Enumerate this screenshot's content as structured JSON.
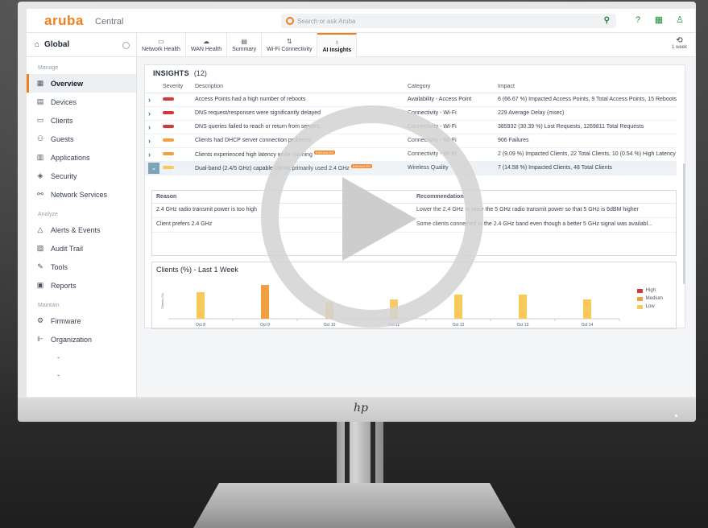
{
  "app": {
    "brand": "aruba",
    "product": "Central",
    "search_placeholder": "Search or ask Aruba",
    "top_icons": [
      "search-icon",
      "help-icon",
      "apps-grid-icon",
      "user-icon"
    ]
  },
  "sidebar": {
    "scope_label": "Global",
    "sections": [
      {
        "label": "Manage",
        "items": [
          {
            "label": "Overview",
            "icon": "grid-icon",
            "glyph": "▦",
            "active": true
          },
          {
            "label": "Devices",
            "icon": "devices-icon",
            "glyph": "▤"
          },
          {
            "label": "Clients",
            "icon": "laptop-icon",
            "glyph": "▭"
          },
          {
            "label": "Guests",
            "icon": "guests-icon",
            "glyph": "⚇"
          },
          {
            "label": "Applications",
            "icon": "applications-icon",
            "glyph": "▥"
          },
          {
            "label": "Security",
            "icon": "shield-icon",
            "glyph": "◈"
          },
          {
            "label": "Network Services",
            "icon": "network-services-icon",
            "glyph": "⚯"
          }
        ]
      },
      {
        "label": "Analyze",
        "items": [
          {
            "label": "Alerts & Events",
            "icon": "bell-icon",
            "glyph": "△"
          },
          {
            "label": "Audit Trail",
            "icon": "audit-icon",
            "glyph": "▨"
          },
          {
            "label": "Tools",
            "icon": "wrench-icon",
            "glyph": "✎"
          },
          {
            "label": "Reports",
            "icon": "reports-icon",
            "glyph": "▣"
          }
        ]
      },
      {
        "label": "Maintain",
        "items": [
          {
            "label": "Firmware",
            "icon": "gear-icon",
            "glyph": "⚙"
          },
          {
            "label": "Organization",
            "icon": "organization-icon",
            "glyph": "⊩"
          }
        ]
      }
    ],
    "trailing": [
      "-",
      "-"
    ]
  },
  "tabs": [
    {
      "label": "Network Health",
      "icon": "monitor-icon",
      "glyph": "▭"
    },
    {
      "label": "WAN Health",
      "icon": "cloud-icon",
      "glyph": "☁"
    },
    {
      "label": "Summary",
      "icon": "summary-icon",
      "glyph": "▤"
    },
    {
      "label": "Wi-Fi Connectivity",
      "icon": "wifi-icon",
      "glyph": "⇅"
    },
    {
      "label": "AI Insights",
      "icon": "lightbulb-icon",
      "glyph": "♁",
      "active": true
    }
  ],
  "time_range": {
    "label": "1 week"
  },
  "insights": {
    "title": "INSIGHTS",
    "count": "(12)",
    "columns": [
      "Severity",
      "Description",
      "Category",
      "Impact"
    ],
    "rows": [
      {
        "severity": "high",
        "description": "Access Points had a high number of reboots",
        "tag": "",
        "category": "Availability - Access Point",
        "impact": "6 (66.67 %) Impacted Access Points, 9 Total Access Points, 15 Reboots"
      },
      {
        "severity": "high",
        "description": "DNS request/responses were significantly delayed",
        "tag": "",
        "category": "Connectivity - Wi-Fi",
        "impact": "229 Average Delay (msec)"
      },
      {
        "severity": "high",
        "description": "DNS queries failed to reach or return from servers",
        "tag": "",
        "category": "Connectivity - Wi-Fi",
        "impact": "385932 (30.39 %) Lost Requests, 1269811 Total Requests"
      },
      {
        "severity": "medium",
        "description": "Clients had DHCP server connection problems",
        "tag": "",
        "category": "Connectivity - Wi-Fi",
        "impact": "906 Failures"
      },
      {
        "severity": "medium",
        "description": "Clients experienced high latency while roaming",
        "tag": "ENHANCED",
        "category": "Connectivity - Wi-Fi",
        "impact": "2 (9.09 %) Impacted Clients, 22 Total Clients, 10 (0.54 %) High Latency"
      },
      {
        "severity": "low",
        "description": "Dual-band (2.4/5 GHz) capable clients primarily used 2.4 GHz",
        "tag": "ENHANCED",
        "category": "Wireless Quality",
        "impact": "7 (14.58 %) Impacted Clients, 48 Total Clients",
        "expanded": true
      }
    ]
  },
  "detail": {
    "columns": [
      "Reason",
      "Recommendation"
    ],
    "rows": [
      {
        "reason": "2.4 GHz radio transmit power is too high",
        "recommendation": "Lower the 2.4 GHz or raise the 5 GHz radio transmit power so that 5 GHz is 6dBM higher"
      },
      {
        "reason": "Client prefers 2.4 GHz",
        "recommendation": "Some clients connected to the 2.4 GHz band even though a better 5 GHz signal was availabl..."
      }
    ]
  },
  "chart_data": {
    "type": "bar",
    "title": "Clients (%) - Last 1 Week",
    "ylabel": "Clients (%)",
    "categories": [
      "Oct 8",
      "Oct 9",
      "Oct 10",
      "Oct 11",
      "Oct 12",
      "Oct 13",
      "Oct 14"
    ],
    "series": [
      {
        "name": "High",
        "color": "#d23a3a",
        "values": [
          0,
          0,
          0,
          0,
          0,
          0,
          0
        ]
      },
      {
        "name": "Medium",
        "color": "#f0a040",
        "values": [
          0,
          14,
          0,
          0,
          0,
          0,
          0
        ]
      },
      {
        "name": "Low",
        "color": "#f7c85a",
        "values": [
          11,
          0,
          7,
          8,
          10,
          10,
          8
        ]
      }
    ],
    "ylim": [
      0,
      16
    ],
    "legend": "right"
  },
  "video": {
    "control": "play-button"
  }
}
